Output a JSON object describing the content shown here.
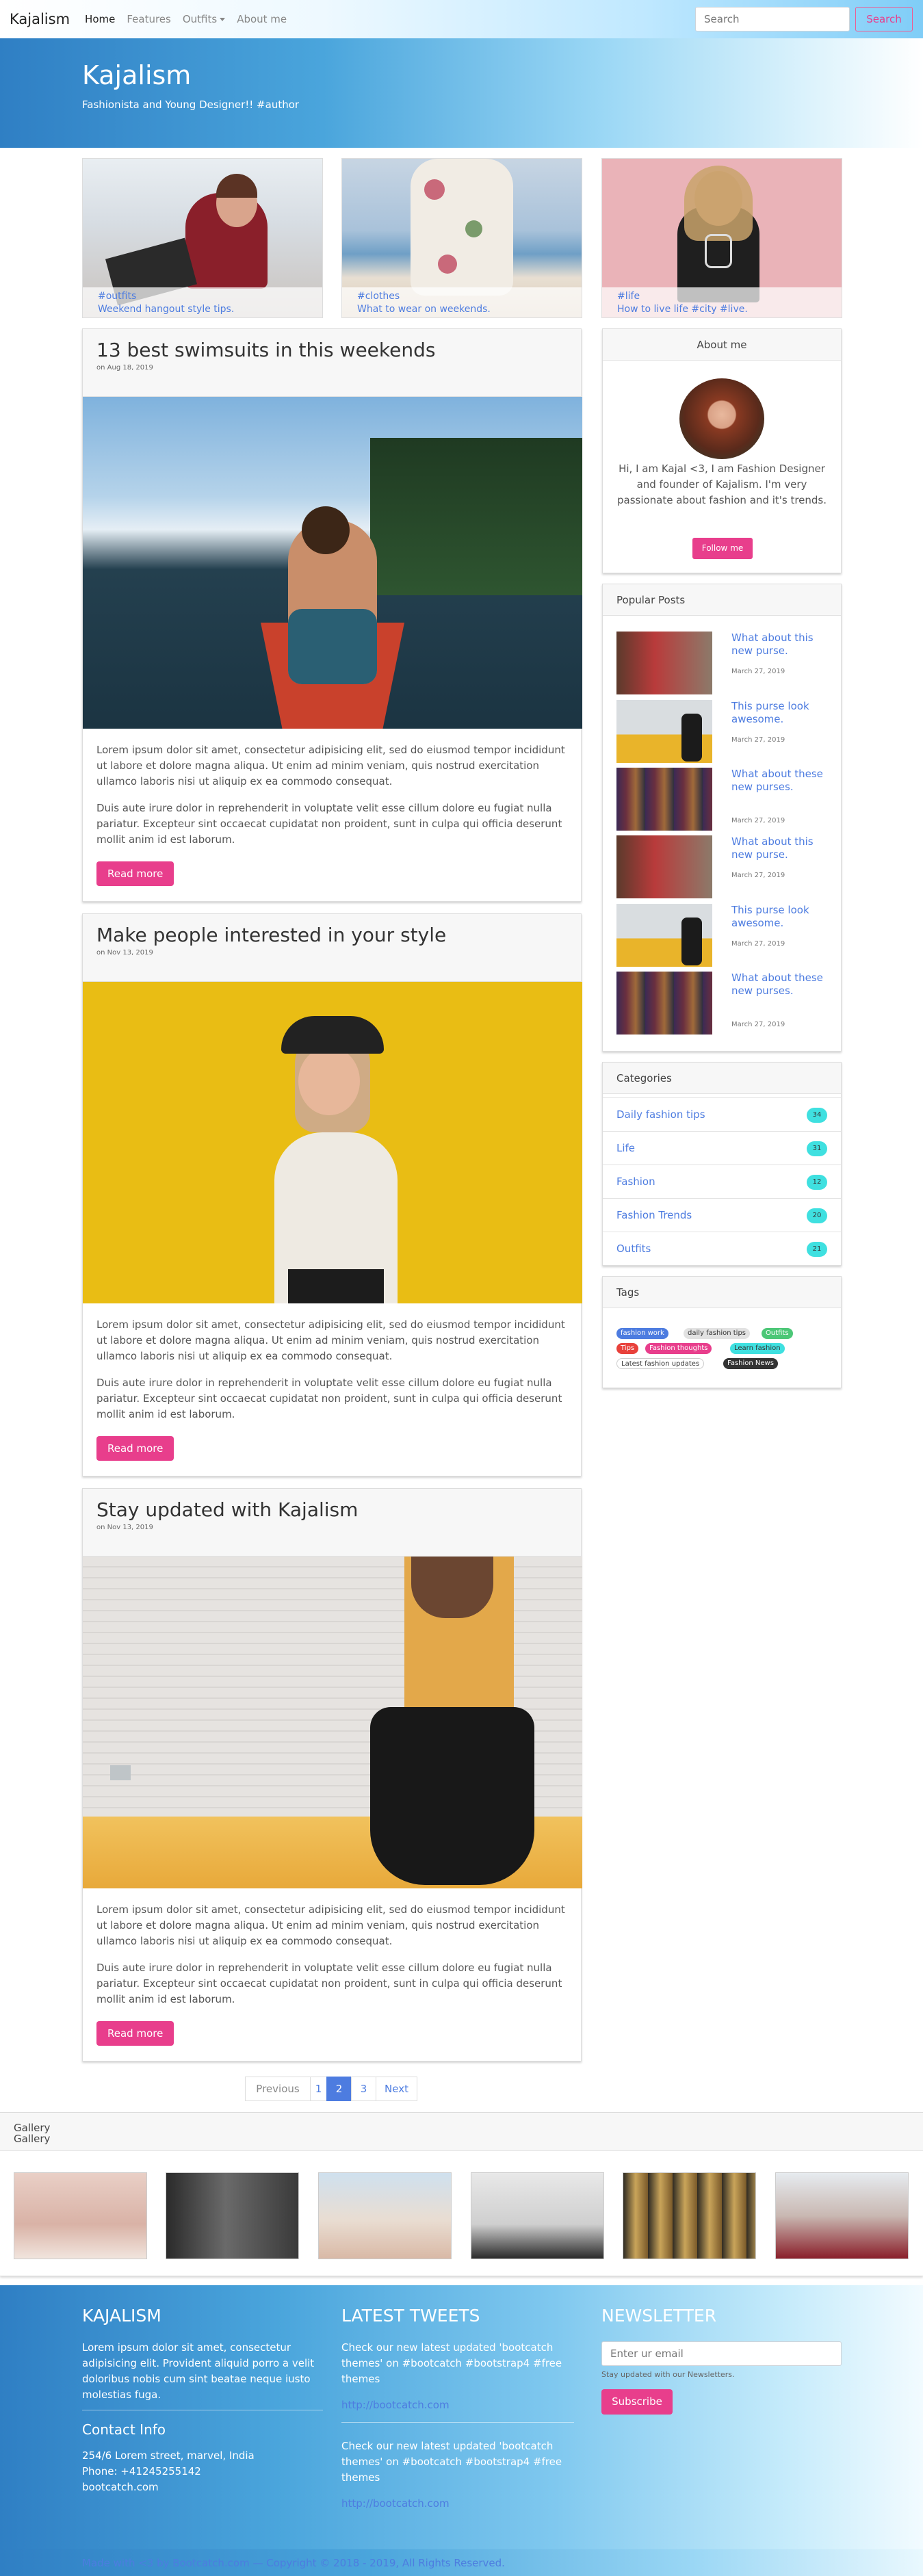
{
  "nav": {
    "brand": "Kajalism",
    "links": [
      "Home",
      "Features",
      "Outfits",
      "About me"
    ],
    "search_placeholder": "Search",
    "search_button": "Search"
  },
  "hero": {
    "title": "Kajalism",
    "subtitle": "Fashionista and Young Designer!! #author"
  },
  "featured": [
    {
      "tag": "#outfits",
      "caption": "Weekend hangout style tips."
    },
    {
      "tag": "#clothes",
      "caption": "What to wear on weekends."
    },
    {
      "tag": "#life",
      "caption": "How to live life #city #live."
    }
  ],
  "posts": [
    {
      "title": "13 best swimsuits in this weekends",
      "date": "on Aug 18, 2019",
      "p1": "Lorem ipsum dolor sit amet, consectetur adipisicing elit, sed do eiusmod tempor incididunt ut labore et dolore magna aliqua. Ut enim ad minim veniam, quis nostrud exercitation ullamco laboris nisi ut aliquip ex ea commodo consequat.",
      "p2": "Duis aute irure dolor in reprehenderit in voluptate velit esse cillum dolore eu fugiat nulla pariatur. Excepteur sint occaecat cupidatat non proident, sunt in culpa qui officia deserunt mollit anim id est laborum.",
      "button": "Read more"
    },
    {
      "title": "Make people interested in your style",
      "date": "on Nov 13, 2019",
      "p1": "Lorem ipsum dolor sit amet, consectetur adipisicing elit, sed do eiusmod tempor incididunt ut labore et dolore magna aliqua. Ut enim ad minim veniam, quis nostrud exercitation ullamco laboris nisi ut aliquip ex ea commodo consequat.",
      "p2": "Duis aute irure dolor in reprehenderit in voluptate velit esse cillum dolore eu fugiat nulla pariatur. Excepteur sint occaecat cupidatat non proident, sunt in culpa qui officia deserunt mollit anim id est laborum.",
      "button": "Read more"
    },
    {
      "title": "Stay updated with Kajalism",
      "date": "on Nov 13, 2019",
      "p1": "Lorem ipsum dolor sit amet, consectetur adipisicing elit, sed do eiusmod tempor incididunt ut labore et dolore magna aliqua. Ut enim ad minim veniam, quis nostrud exercitation ullamco laboris nisi ut aliquip ex ea commodo consequat.",
      "p2": "Duis aute irure dolor in reprehenderit in voluptate velit esse cillum dolore eu fugiat nulla pariatur. Excepteur sint occaecat cupidatat non proident, sunt in culpa qui officia deserunt mollit anim id est laborum.",
      "button": "Read more"
    }
  ],
  "about": {
    "heading": "About me",
    "text": "Hi, I am Kajal <3, I am Fashion Designer and founder of Kajalism. I'm very passionate about fashion and it's trends.",
    "button": "Follow me"
  },
  "popular": {
    "heading": "Popular Posts",
    "items": [
      {
        "title": "What about this new purse.",
        "date": "March 27, 2019"
      },
      {
        "title": "This purse look awesome.",
        "date": "March 27, 2019"
      },
      {
        "title": "What about these new purses.",
        "date": "March 27, 2019"
      },
      {
        "title": "What about this new purse.",
        "date": "March 27, 2019"
      },
      {
        "title": "This purse look awesome.",
        "date": "March 27, 2019"
      },
      {
        "title": "What about these new purses.",
        "date": "March 27, 2019"
      }
    ]
  },
  "categories": {
    "heading": "Categories",
    "items": [
      {
        "label": "Daily fashion tips",
        "count": "34"
      },
      {
        "label": "Life",
        "count": "31"
      },
      {
        "label": "Fashion",
        "count": "12"
      },
      {
        "label": "Fashion Trends",
        "count": "20"
      },
      {
        "label": "Outfits",
        "count": "21"
      }
    ]
  },
  "tags": {
    "heading": "Tags",
    "items": [
      "fashion work",
      "daily fashion tips",
      "Outfits",
      "Tips",
      "Fashion thoughts",
      "Learn fashion",
      "Latest fashion updates",
      "Fashion News"
    ]
  },
  "pagination": [
    "Previous",
    "1",
    "2",
    "3",
    "Next"
  ],
  "gallery": {
    "heading": "Gallery",
    "label": "Gallery"
  },
  "footer": {
    "about_heading": "KAJALISM",
    "about_text": "Lorem ipsum dolor sit amet, consectetur adipisicing elit. Provident aliquid porro a velit doloribus nobis cum sint beatae neque iusto molestias fuga.",
    "contact_heading": "Contact Info",
    "address": "254/6 Lorem street, marvel, India",
    "phone": "Phone: +41245255142",
    "site": "bootcatch.com",
    "tweets_heading": "LATEST TWEETS",
    "tweet1": "Check our new latest updated 'bootcatch themes' on #bootcatch #bootstrap4 #free themes",
    "tweet1_link": "http://bootcatch.com",
    "tweet2": "Check our new latest updated 'bootcatch themes' on #bootcatch #bootstrap4 #free themes",
    "tweet2_link": "http://bootcatch.com",
    "newsletter_heading": "NEWSLETTER",
    "email_placeholder": "Enter ur email",
    "newsletter_note": "Stay updated with our Newsletters.",
    "subscribe": "Subscribe",
    "copyright": "Made with <3 by Bootcatch.com — Copyright © 2018 - 2019, All Rights Reserved."
  },
  "colors": {
    "accent": "#e83e8c",
    "link": "#4d7ce0",
    "badge": "#3fe0e0",
    "hero": "#4aa5dc"
  }
}
